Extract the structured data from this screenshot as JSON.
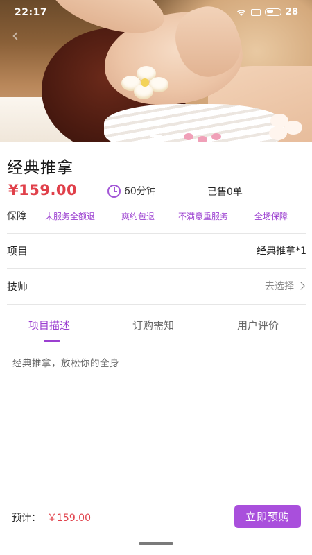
{
  "status_bar": {
    "time": "22:17",
    "battery_level": "28"
  },
  "hero": {
    "carousel_index": 1
  },
  "service": {
    "title": "经典推拿",
    "price": "¥159.00",
    "duration": "60分钟",
    "sold": "已售0单"
  },
  "guarantee": {
    "label": "保障",
    "tags": [
      "未服务全额退",
      "爽约包退",
      "不满意重服务",
      "全场保障"
    ]
  },
  "project_row": {
    "label": "项目",
    "value": "经典推拿*1"
  },
  "technician_row": {
    "label": "技师",
    "action": "去选择"
  },
  "tabs": [
    {
      "label": "项目描述",
      "active": true
    },
    {
      "label": "订购需知",
      "active": false
    },
    {
      "label": "用户评价",
      "active": false
    }
  ],
  "description": "经典推拿，放松你的全身",
  "bottom_bar": {
    "estimate_label": "预计：",
    "estimate_price": "￥159.00",
    "book_button": "立即预购"
  },
  "colors": {
    "accent": "#a94fdc",
    "price": "#e0404a"
  },
  "icons": [
    "wifi-icon",
    "sim-icon",
    "battery-icon",
    "back-arrow-icon",
    "clock-icon",
    "chevron-right-icon"
  ]
}
